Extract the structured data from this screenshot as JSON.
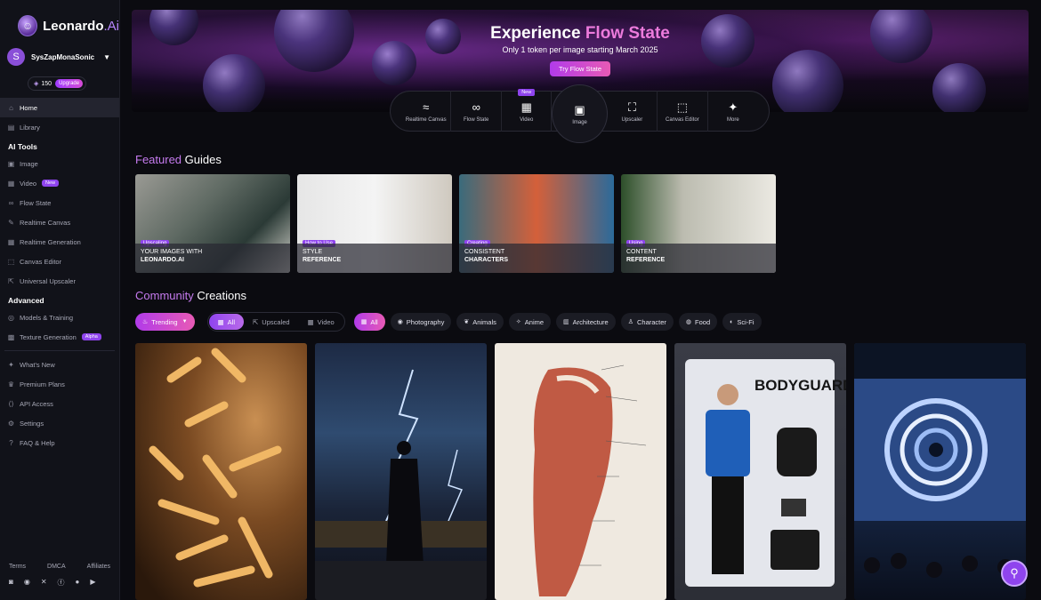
{
  "app": {
    "brand": "Leonardo",
    "brand_suffix": ".Ai"
  },
  "user": {
    "initial": "S",
    "name": "SysZapMonaSonic",
    "tokens": "150",
    "upgrade_label": "Upgrade"
  },
  "sidebar": {
    "top_items": [
      {
        "label": "Home",
        "icon": "home-icon",
        "active": true
      },
      {
        "label": "Library",
        "icon": "library-icon"
      }
    ],
    "ai_tools_heading": "AI Tools",
    "ai_tools": [
      {
        "label": "Image",
        "icon": "image-icon"
      },
      {
        "label": "Video",
        "icon": "video-icon",
        "badge": "New"
      },
      {
        "label": "Flow State",
        "icon": "infinity-icon"
      },
      {
        "label": "Realtime Canvas",
        "icon": "brush-icon"
      },
      {
        "label": "Realtime Generation",
        "icon": "grid-icon"
      },
      {
        "label": "Canvas Editor",
        "icon": "canvas-icon"
      },
      {
        "label": "Universal Upscaler",
        "icon": "upscale-icon"
      }
    ],
    "advanced_heading": "Advanced",
    "advanced": [
      {
        "label": "Models & Training",
        "icon": "model-icon"
      },
      {
        "label": "Texture Generation",
        "icon": "texture-icon",
        "badge": "Alpha"
      }
    ],
    "bottom_items": [
      {
        "label": "What's New",
        "icon": "sparkle-icon"
      },
      {
        "label": "Premium Plans",
        "icon": "crown-icon"
      },
      {
        "label": "API Access",
        "icon": "api-icon"
      },
      {
        "label": "Settings",
        "icon": "gear-icon"
      },
      {
        "label": "FAQ & Help",
        "icon": "help-icon"
      }
    ],
    "footer_links": [
      "Terms",
      "DMCA",
      "Affiliates"
    ]
  },
  "hero": {
    "title_plain": "Experience ",
    "title_accent": "Flow State",
    "subtitle": "Only 1 token per image starting March 2025",
    "cta": "Try Flow State"
  },
  "tools": [
    {
      "label": "Realtime Canvas",
      "icon": "realtime-canvas-icon",
      "glyph": "≈"
    },
    {
      "label": "Flow State",
      "icon": "infinity-icon",
      "glyph": "∞"
    },
    {
      "label": "Video",
      "icon": "video-icon",
      "glyph": "▦",
      "tag": "New"
    },
    {
      "label": "Image",
      "icon": "image-icon",
      "glyph": "▣"
    },
    {
      "label": "Upscaler",
      "icon": "upscaler-icon",
      "glyph": "⛶"
    },
    {
      "label": "Canvas Editor",
      "icon": "canvas-editor-icon",
      "glyph": "⬚"
    },
    {
      "label": "More",
      "icon": "more-icon",
      "glyph": "✦"
    }
  ],
  "featured": {
    "title_accent": "Featured",
    "title_rest": " Guides",
    "guides": [
      {
        "tag": "Upscaling",
        "line1": "YOUR IMAGES WITH",
        "line2": "LEONARDO.AI"
      },
      {
        "tag": "How to Use",
        "line1": "STYLE",
        "line2": "REFERENCE"
      },
      {
        "tag": "Creating",
        "line1": "CONSISTENT",
        "line2": "CHARACTERS"
      },
      {
        "tag": "Using",
        "line1": "CONTENT",
        "line2": "REFERENCE"
      }
    ]
  },
  "community": {
    "title_accent": "Community",
    "title_rest": " Creations",
    "trending": "Trending",
    "media_tabs": [
      "All",
      "Upscaled",
      "Video"
    ],
    "categories": [
      {
        "label": "All",
        "icon": "grid-icon"
      },
      {
        "label": "Photography",
        "icon": "camera-icon"
      },
      {
        "label": "Animals",
        "icon": "paw-icon"
      },
      {
        "label": "Anime",
        "icon": "star-icon"
      },
      {
        "label": "Architecture",
        "icon": "building-icon"
      },
      {
        "label": "Character",
        "icon": "person-icon"
      },
      {
        "label": "Food",
        "icon": "food-icon"
      },
      {
        "label": "Sci-Fi",
        "icon": "planet-icon"
      }
    ],
    "tile_text": {
      "bodyguard": "BODYGUARD"
    }
  }
}
